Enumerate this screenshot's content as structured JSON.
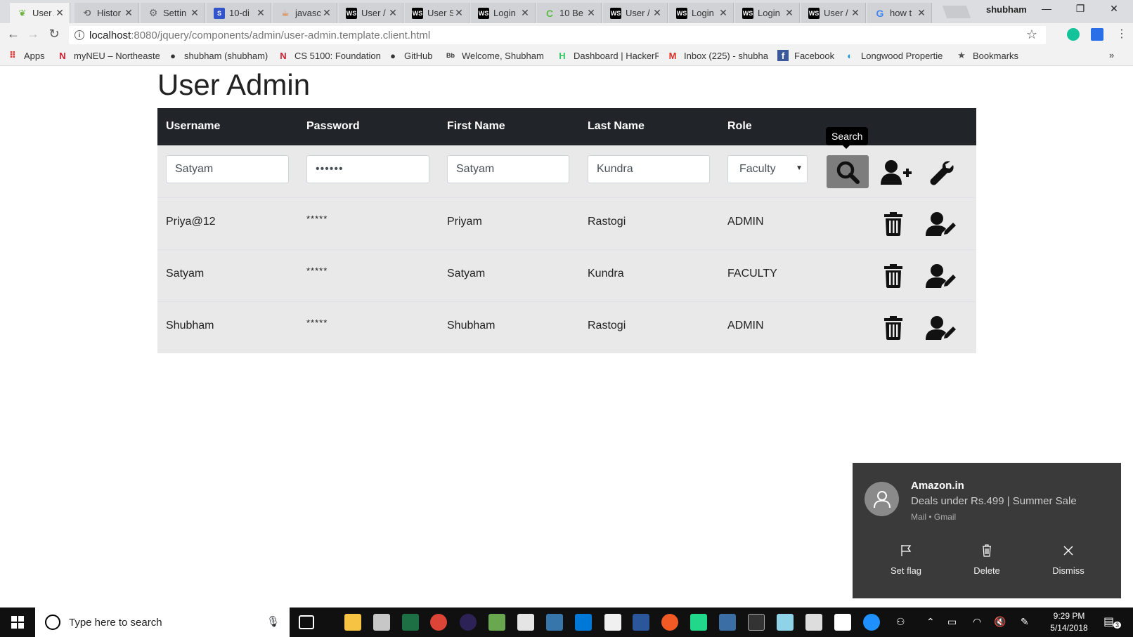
{
  "browser": {
    "tabs": [
      {
        "title": "User A",
        "icon": "leaf-icon",
        "color": "#6db33f",
        "active": true
      },
      {
        "title": "Histor",
        "icon": "history-icon",
        "color": "#666666"
      },
      {
        "title": "Settin",
        "icon": "gear-icon",
        "color": "#666666"
      },
      {
        "title": "10-di",
        "icon": "sans-icon",
        "color": "#3355cc"
      },
      {
        "title": "javasc",
        "icon": "java-icon",
        "color": "#e07020"
      },
      {
        "title": "User /",
        "icon": "webstorm-icon",
        "color": "#000000"
      },
      {
        "title": "User S",
        "icon": "webstorm-icon",
        "color": "#000000"
      },
      {
        "title": "Login",
        "icon": "webstorm-icon",
        "color": "#000000"
      },
      {
        "title": "10 Be",
        "icon": "c-icon",
        "color": "#5fba46"
      },
      {
        "title": "User /",
        "icon": "webstorm-icon",
        "color": "#000000"
      },
      {
        "title": "Login",
        "icon": "webstorm-icon",
        "color": "#000000"
      },
      {
        "title": "Login",
        "icon": "webstorm-icon",
        "color": "#000000"
      },
      {
        "title": "User /",
        "icon": "webstorm-icon",
        "color": "#000000"
      },
      {
        "title": "how t",
        "icon": "google-icon",
        "color": "#4285f4"
      }
    ],
    "profile_name": "shubham",
    "url_host": "localhost",
    "url_path": ":8080/jquery/components/admin/user-admin.template.client.html",
    "bookmarks": [
      {
        "label": "Apps",
        "icon": "apps-grid-icon"
      },
      {
        "label": "myNEU – Northeaste",
        "icon": "neu-icon"
      },
      {
        "label": "shubham (shubham)",
        "icon": "github-icon"
      },
      {
        "label": "CS 5100: Foundation",
        "icon": "neu-icon"
      },
      {
        "label": "GitHub",
        "icon": "github-icon"
      },
      {
        "label": "Welcome, Shubham",
        "icon": "blackboard-icon"
      },
      {
        "label": "Dashboard | HackerR",
        "icon": "hackerrank-icon"
      },
      {
        "label": "Inbox (225) - shubha",
        "icon": "gmail-icon"
      },
      {
        "label": "Facebook",
        "icon": "facebook-icon"
      },
      {
        "label": "Longwood Propertie",
        "icon": "longwood-icon"
      },
      {
        "label": "Bookmarks",
        "icon": "star-icon"
      }
    ]
  },
  "page": {
    "title": "User Admin",
    "columns": [
      "Username",
      "Password",
      "First Name",
      "Last Name",
      "Role"
    ],
    "form": {
      "username": "Satyam",
      "password": "••••••",
      "first_name": "Satyam",
      "last_name": "Kundra",
      "role": "Faculty",
      "search_tooltip": "Search"
    },
    "rows": [
      {
        "username": "Priya@12",
        "password": "*****",
        "first_name": "Priyam",
        "last_name": "Rastogi",
        "role": "ADMIN"
      },
      {
        "username": "Satyam",
        "password": "*****",
        "first_name": "Satyam",
        "last_name": "Kundra",
        "role": "FACULTY"
      },
      {
        "username": "Shubham",
        "password": "*****",
        "first_name": "Shubham",
        "last_name": "Rastogi",
        "role": "ADMIN"
      }
    ]
  },
  "notification": {
    "sender": "Amazon.in",
    "message": "Deals under Rs.499 | Summer Sale",
    "source": "Mail • Gmail",
    "actions": [
      "Set flag",
      "Delete",
      "Dismiss"
    ]
  },
  "taskbar": {
    "search_placeholder": "Type here to search",
    "time": "9:29 PM",
    "date": "5/14/2018",
    "notification_count": "3"
  }
}
